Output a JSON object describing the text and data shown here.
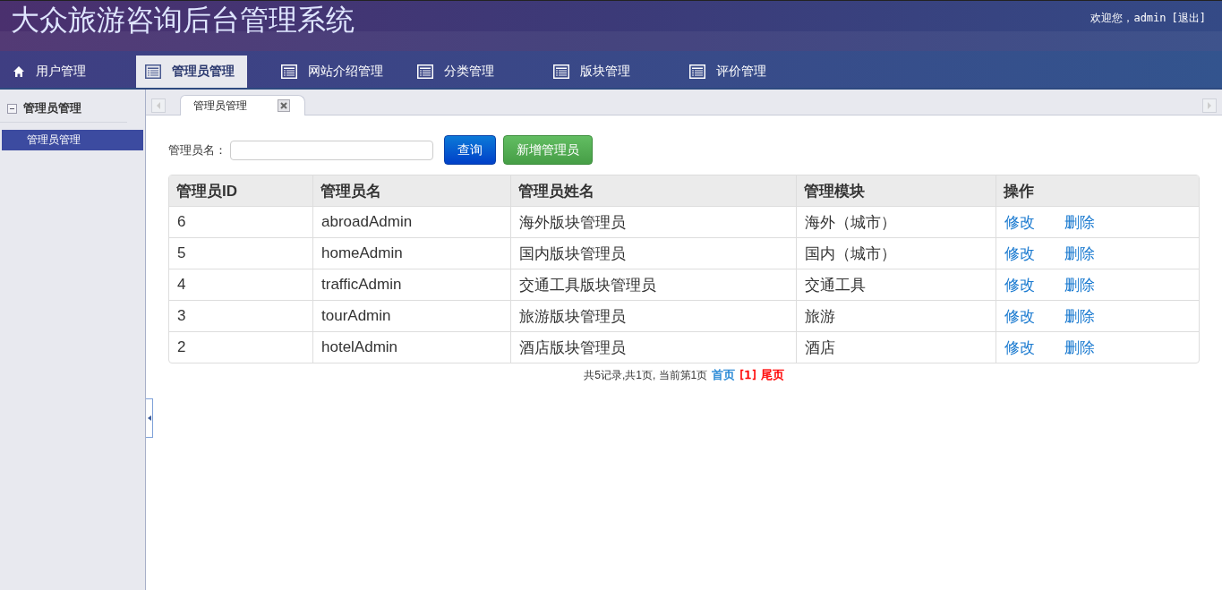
{
  "header": {
    "title": "大众旅游咨询后台管理系统",
    "welcome": "欢迎您，admin",
    "logout": "[退出]"
  },
  "nav": [
    {
      "label": "用户管理",
      "kind": "home",
      "selected": false
    },
    {
      "label": "管理员管理",
      "kind": "list",
      "selected": true
    },
    {
      "label": "网站介绍管理",
      "kind": "list",
      "selected": false
    },
    {
      "label": "分类管理",
      "kind": "list",
      "selected": false
    },
    {
      "label": "版块管理",
      "kind": "list",
      "selected": false
    },
    {
      "label": "评价管理",
      "kind": "list",
      "selected": false
    }
  ],
  "sidebar": {
    "group": {
      "label": "管理员管理",
      "expanded": true
    },
    "items": [
      {
        "label": "管理员管理",
        "selected": true
      }
    ]
  },
  "tabs": [
    {
      "label": "管理员管理",
      "selected": true
    }
  ],
  "search": {
    "label": "管理员名：",
    "buttons": [
      {
        "label": "查询",
        "kind": "primary"
      },
      {
        "label": "新增管理员",
        "kind": "success"
      }
    ]
  },
  "table": {
    "columns": [
      "管理员ID",
      "管理员名",
      "管理员姓名",
      "管理模块",
      "操作"
    ],
    "rows": [
      {
        "cells": [
          "6",
          "abroadAdmin",
          "海外版块管理员",
          "海外（城市）"
        ],
        "actions": [
          "修改",
          "删除"
        ]
      },
      {
        "cells": [
          "5",
          "homeAdmin",
          "国内版块管理员",
          "国内（城市）"
        ],
        "actions": [
          "修改",
          "删除"
        ]
      },
      {
        "cells": [
          "4",
          "trafficAdmin",
          "交通工具版块管理员",
          "交通工具"
        ],
        "actions": [
          "修改",
          "删除"
        ]
      },
      {
        "cells": [
          "3",
          "tourAdmin",
          "旅游版块管理员",
          "旅游"
        ],
        "actions": [
          "修改",
          "删除"
        ]
      },
      {
        "cells": [
          "2",
          "hotelAdmin",
          "酒店版块管理员",
          "酒店"
        ],
        "actions": [
          "修改",
          "删除"
        ]
      }
    ]
  },
  "pager": {
    "summary": "共5记录,共1页, 当前第1页",
    "links": [
      {
        "label": "首页",
        "color": "#2a8ad6"
      },
      {
        "label": "[1]",
        "color": "#ff0000"
      },
      {
        "label": "尾页",
        "color": "#ff0000"
      }
    ]
  }
}
